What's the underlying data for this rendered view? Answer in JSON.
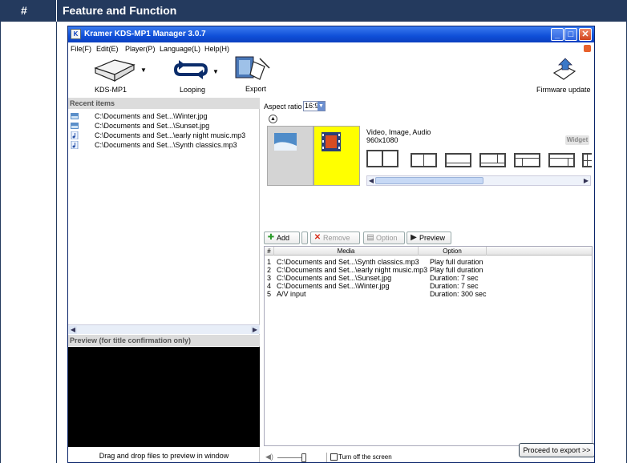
{
  "doc": {
    "col_hash": "#",
    "col_title": "Feature and Function"
  },
  "window": {
    "title": "Kramer KDS-MP1 Manager 3.0.7",
    "app_icon": "K"
  },
  "menu": {
    "file": "File(F)",
    "edit": "Edit(E)",
    "player": "Player(P)",
    "language": "Language(L)",
    "help": "Help(H)"
  },
  "toolbar": {
    "device": "KDS-MP1",
    "looping": "Looping",
    "export": "Export",
    "firmware": "Firmware update"
  },
  "left": {
    "recent_title": "Recent items",
    "recent": [
      {
        "icon": "image-file-icon",
        "path": "C:\\Documents and Set...\\Winter.jpg"
      },
      {
        "icon": "image-file-icon",
        "path": "C:\\Documents and Set...\\Sunset.jpg"
      },
      {
        "icon": "music-file-icon",
        "path": "C:\\Documents and Set...\\early night music.mp3"
      },
      {
        "icon": "music-file-icon",
        "path": "C:\\Documents and Set...\\Synth classics.mp3"
      }
    ],
    "preview_title": "Preview (for title confirmation only)",
    "drag_text": "Drag and drop files to preview in window"
  },
  "right": {
    "aspect_label": "Aspect ratio",
    "aspect_value": "16:9",
    "media_type": "Video, Image, Audio",
    "resolution": "960x1080",
    "widget": "Widget",
    "buttons": {
      "add": "Add",
      "remove": "Remove",
      "option": "Option",
      "preview": "Preview"
    },
    "table": {
      "headers": [
        "#",
        "Media",
        "Option"
      ],
      "rows": [
        {
          "n": "1",
          "media": "C:\\Documents and Set...\\Synth classics.mp3",
          "option": "Play full duration"
        },
        {
          "n": "2",
          "media": "C:\\Documents and Set...\\early night music.mp3",
          "option": "Play full duration"
        },
        {
          "n": "3",
          "media": "C:\\Documents and Set...\\Sunset.jpg",
          "option": "Duration: 7 sec"
        },
        {
          "n": "4",
          "media": "C:\\Documents and Set...\\Winter.jpg",
          "option": "Duration: 7 sec"
        },
        {
          "n": "5",
          "media": "A/V input",
          "option": "Duration: 300 sec"
        }
      ]
    },
    "turn_off": "Turn off the screen",
    "proceed": "Proceed to export >>"
  },
  "colors": {
    "doc_header": "#243a5e",
    "titlebar": "#0f4fd8",
    "thumb_yellow": "#ffff00"
  }
}
